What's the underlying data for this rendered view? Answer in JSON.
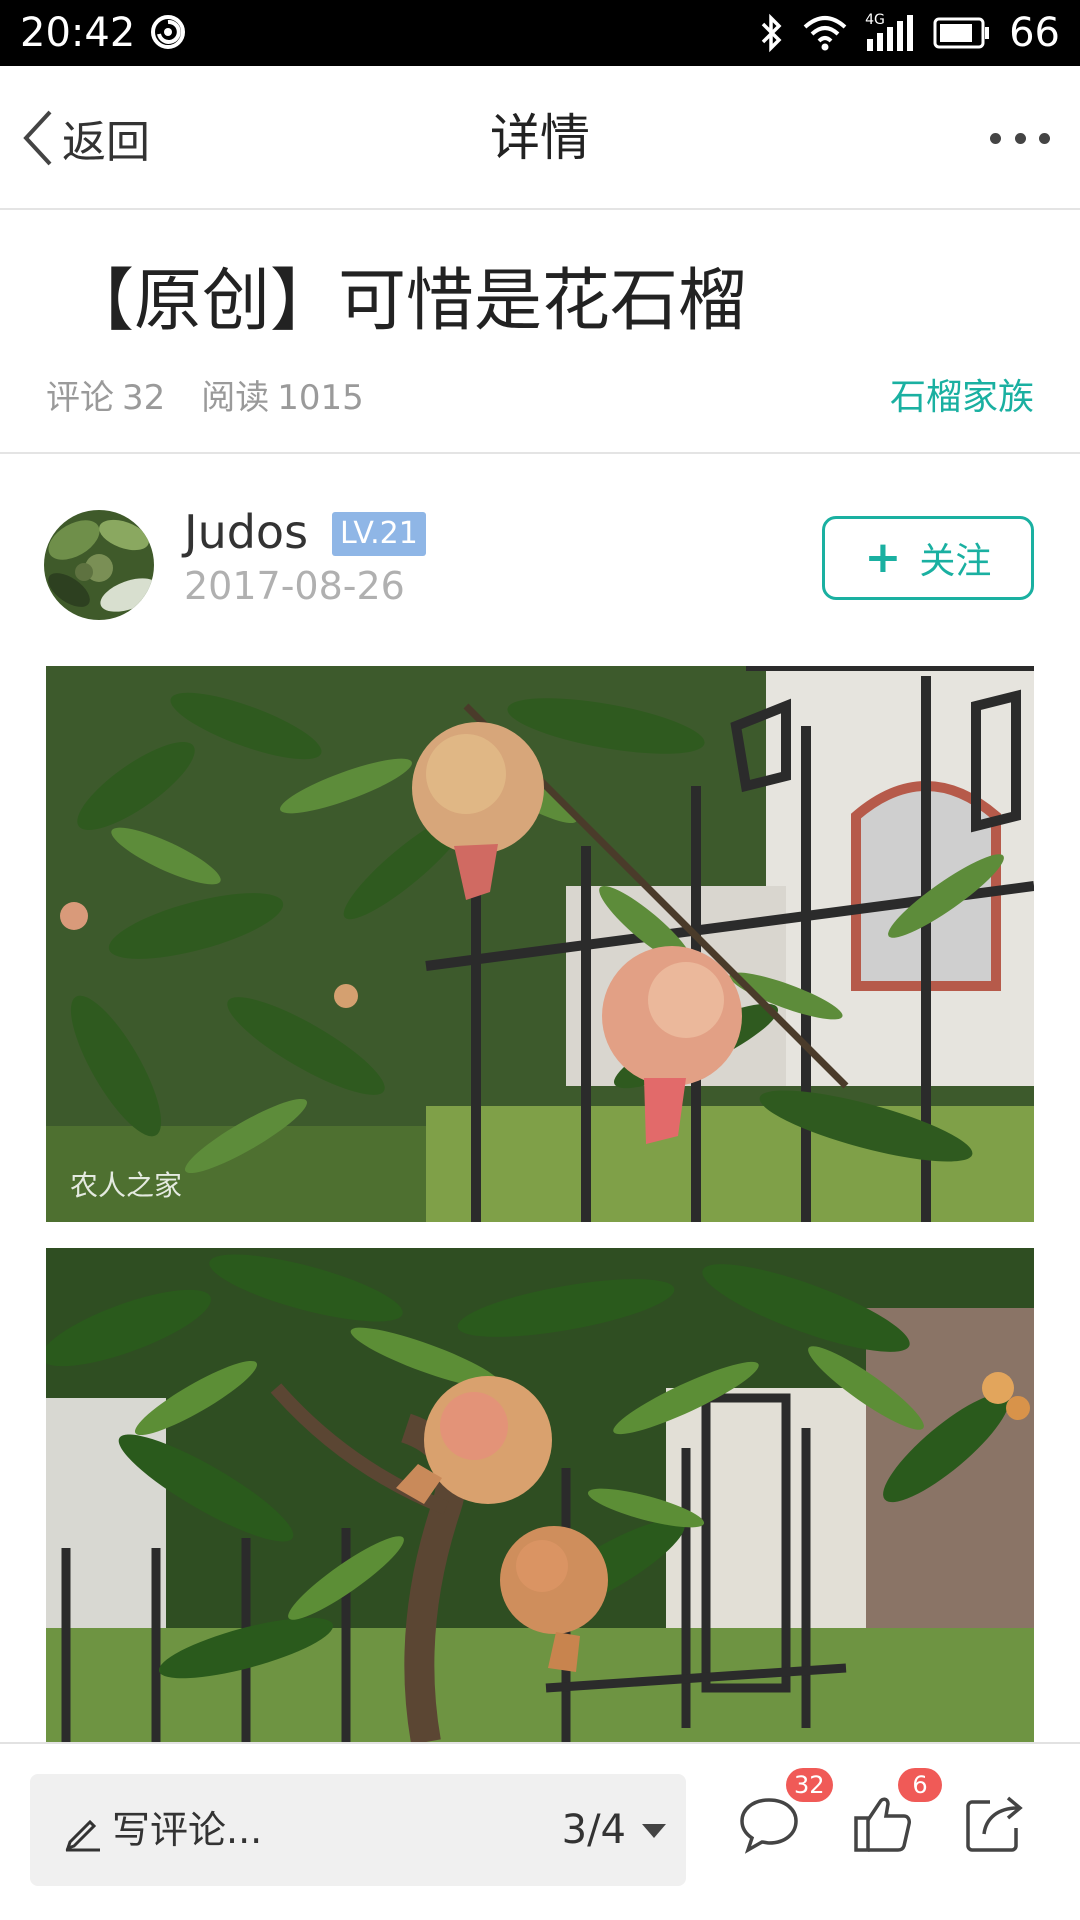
{
  "status_bar": {
    "time": "20:42",
    "icons": [
      "app-spiral-icon",
      "bluetooth-icon",
      "wifi-icon",
      "signal-4g-icon",
      "battery-icon"
    ],
    "signal_label": "4G",
    "battery_level": "66"
  },
  "nav": {
    "back_label": "返回",
    "title": "详情",
    "more_icon": "more-dots-icon"
  },
  "article": {
    "title": "【原创】可惜是花石榴",
    "comments_label": "评论",
    "comments_count": "32",
    "reads_label": "阅读",
    "reads_count": "1015",
    "category": "石榴家族"
  },
  "author": {
    "name": "Judos",
    "level": "LV.21",
    "date": "2017-08-26",
    "follow_plus": "+",
    "follow_label": "关注"
  },
  "photos": [
    {
      "subject": "pomegranates on tree by iron fence",
      "watermark": "农人之家"
    },
    {
      "subject": "pomegranates on tree branches"
    }
  ],
  "bottom_bar": {
    "comment_placeholder": "写评论...",
    "page_indicator": "3/4",
    "comment_count_badge": "32",
    "like_count_badge": "6",
    "icons": [
      "pencil-icon",
      "comment-bubble-icon",
      "thumbs-up-icon",
      "share-icon"
    ]
  },
  "colors": {
    "accent": "#1ab0a1",
    "badge": "#f05a57",
    "level_badge": "#8fb6e6",
    "status_bar": "#000000"
  }
}
